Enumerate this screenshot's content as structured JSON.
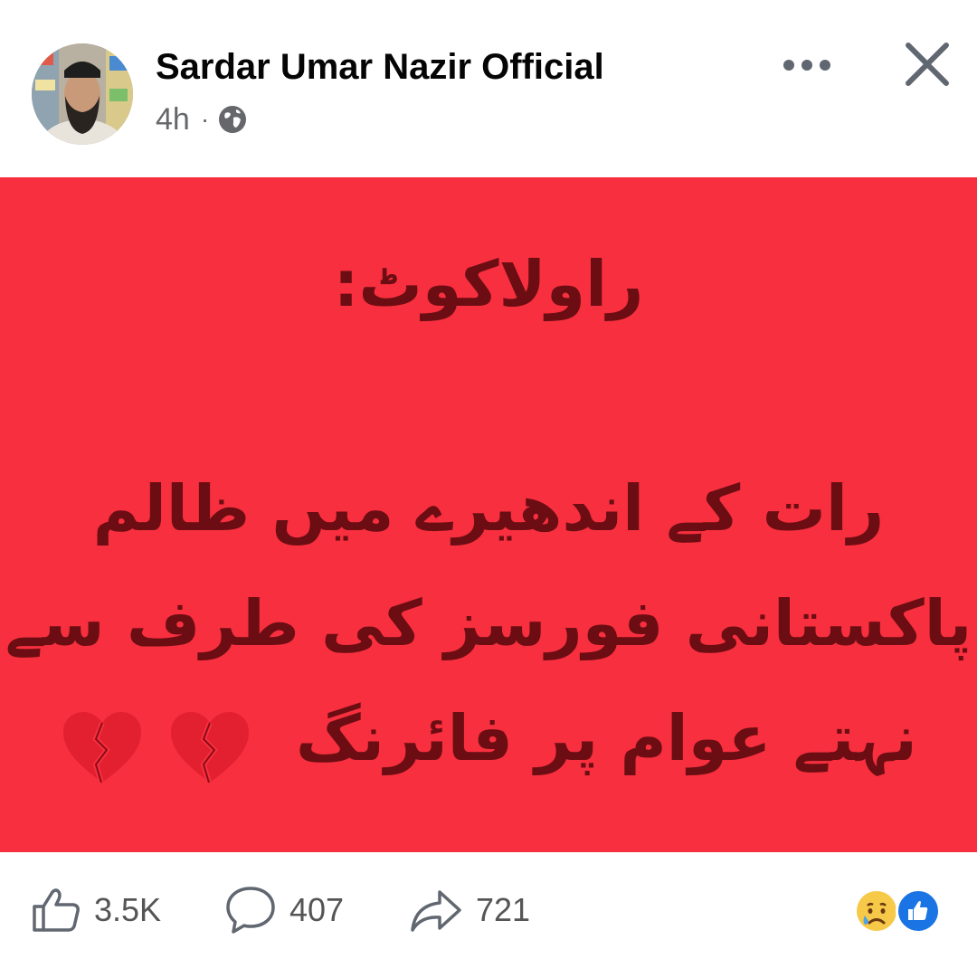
{
  "post": {
    "author": "Sardar Umar Nazir Official",
    "time": "4h",
    "separator": "·",
    "privacy_icon": "globe-icon",
    "more_icon": "more-options-icon",
    "close_icon": "close-icon"
  },
  "content": {
    "background_color": "#f72f3f",
    "text_color": "#6b0d12",
    "lines": [
      "راولاکوٹ:",
      "رات کے اندھیرے میں ظالم",
      "پاکستانی فورسز کی طرف سے",
      "نہتے عوام پر فائرنگ"
    ],
    "emoji": [
      "💔",
      "💔"
    ]
  },
  "footer": {
    "like_count": "3.5K",
    "comment_count": "407",
    "share_count": "721",
    "reaction_icons": [
      "sad-reaction-icon",
      "like-reaction-icon"
    ]
  }
}
